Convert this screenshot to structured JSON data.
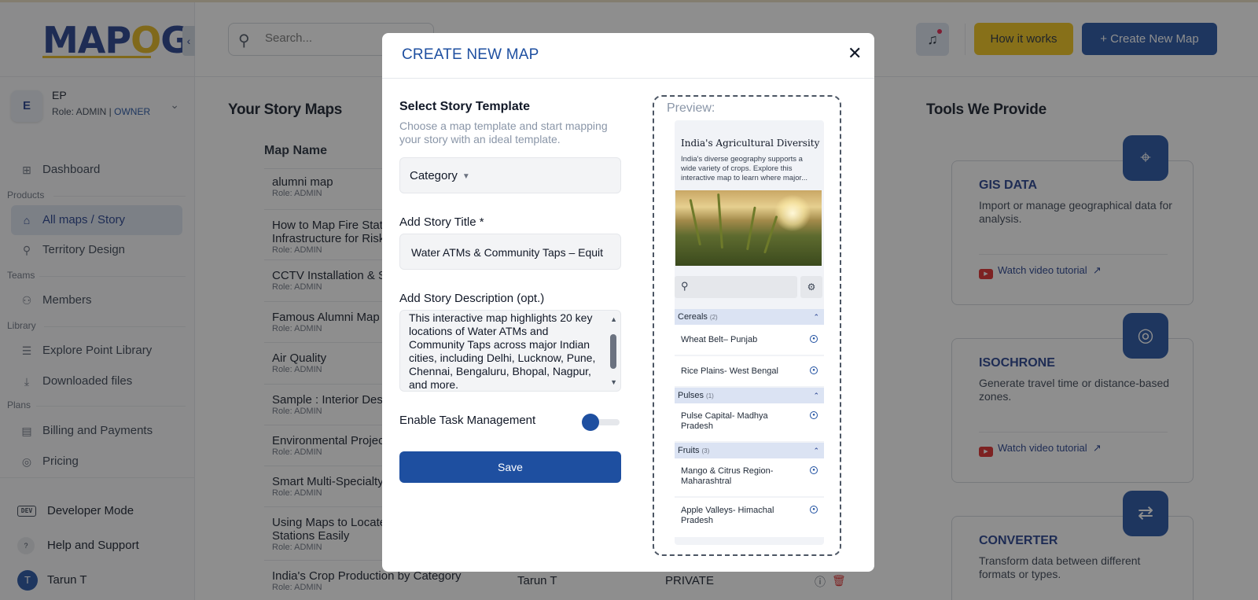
{
  "app": {
    "logo_left": "MAP",
    "logo_o": "O",
    "logo_right": "G"
  },
  "sidebar": {
    "user": {
      "initial": "E",
      "name": "EP",
      "role_prefix": "Role: ADMIN | ",
      "role_owner": "OWNER"
    },
    "dashboard": "Dashboard",
    "sections": {
      "products": "Products",
      "teams": "Teams",
      "library": "Library",
      "plans": "Plans"
    },
    "items": {
      "all_maps": "All maps / Story",
      "territory": "Territory Design",
      "members": "Members",
      "explore": "Explore Point Library",
      "downloaded": "Downloaded files",
      "billing": "Billing and Payments",
      "pricing": "Pricing"
    },
    "bottom": {
      "dev_badge": "DEV",
      "developer": "Developer Mode",
      "help": "Help and Support",
      "user_initial": "T",
      "user_name": "Tarun T"
    }
  },
  "header": {
    "search_placeholder": "Search...",
    "how_it_works": "How it works",
    "create_new_map": "+ Create New Map"
  },
  "main": {
    "story_maps_title": "Your Story Maps",
    "col_map_name": "Map Name",
    "rows": [
      {
        "name": "alumni map",
        "role": "Role: ADMIN"
      },
      {
        "name": "How to Map Fire Stati Infrastructure for Risk",
        "role": "Role: ADMIN"
      },
      {
        "name": "CCTV Installation & Se",
        "role": "Role: ADMIN"
      },
      {
        "name": "Famous Alumni Map",
        "role": "Role: ADMIN"
      },
      {
        "name": "Air Quality",
        "role": "Role: ADMIN"
      },
      {
        "name": "Sample : Interior Desi",
        "role": "Role: ADMIN"
      },
      {
        "name": "Environmental Project",
        "role": "Role: ADMIN"
      },
      {
        "name": "Smart Multi-Specialty",
        "role": "Role: ADMIN"
      },
      {
        "name": "Using Maps to Locate Stations Easily",
        "role": "Role: ADMIN"
      },
      {
        "name": "India's Crop Production by Category",
        "role": "Role: ADMIN",
        "owner": "Tarun T",
        "visibility": "PRIVATE"
      }
    ],
    "tools_title": "Tools We Provide",
    "tools": [
      {
        "name": "GIS DATA",
        "desc": "Import or manage geographical data for analysis.",
        "video": "Watch video tutorial",
        "icon": "map-pin-icon"
      },
      {
        "name": "ISOCHRONE",
        "desc": "Generate travel time or distance-based zones.",
        "video": "Watch video tutorial",
        "icon": "target-icon"
      },
      {
        "name": "CONVERTER",
        "desc": "Transform data between different formats or types.",
        "video": "",
        "icon": "convert-icon"
      }
    ]
  },
  "modal": {
    "title": "CREATE NEW MAP",
    "select_template_label": "Select Story Template",
    "select_template_help": "Choose a map template and start mapping your story with an ideal template.",
    "category_value": "Category",
    "story_title_label": "Add Story Title *",
    "story_title_value": "Water ATMs & Community Taps – Equit",
    "story_desc_label": "Add Story Description (opt.)",
    "story_desc_value": "This interactive map highlights 20 key locations of Water ATMs and Community Taps across major Indian cities, including Delhi, Lucknow, Pune, Chennai, Bengaluru, Bhopal, Nagpur, and more.",
    "task_mgmt_label": "Enable Task Management",
    "save_label": "Save"
  },
  "preview": {
    "label": "Preview:",
    "title": "India's Agricultural Diversity",
    "desc": "India's diverse geography supports a wide variety of crops. Explore this interactive map to learn where major...",
    "categories": [
      {
        "name": "Cereals",
        "count": "(2)",
        "items": [
          "Wheat Belt– Punjab",
          "Rice Plains- West Bengal"
        ]
      },
      {
        "name": "Pulses",
        "count": "(1)",
        "items": [
          "Pulse Capital- Madhya Pradesh"
        ]
      },
      {
        "name": "Fruits",
        "count": "(3)",
        "items": [
          "Mango & Citrus Region- Maharashtral",
          "Apple Valleys- Himachal Pradesh"
        ]
      }
    ]
  }
}
